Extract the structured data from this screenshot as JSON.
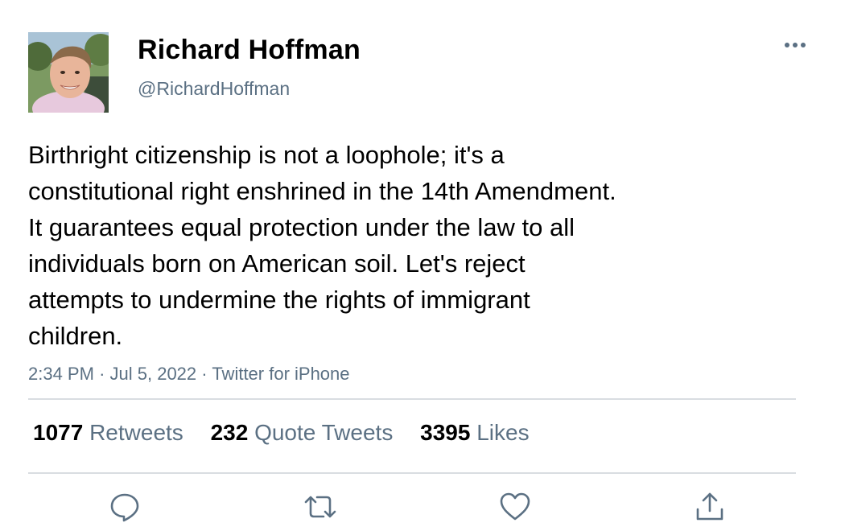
{
  "author": {
    "display_name": "Richard Hoffman",
    "handle": "@RichardHoffman",
    "avatar_icon": "profile-photo"
  },
  "tweet": {
    "text": "Birthright citizenship is not a loophole; it's a\nconstitutional right enshrined in the 14th Amendment.\nIt guarantees equal protection under the law to all\nindividuals born on American soil. Let's reject\nattempts to undermine the rights of immigrant\nchildren.",
    "time": "2:34 PM",
    "date": "Jul 5, 2022",
    "source": "Twitter for iPhone",
    "separator": "·"
  },
  "stats": {
    "retweets_count": "1077",
    "retweets_label": "Retweets",
    "quotes_count": "232",
    "quotes_label": "Quote Tweets",
    "likes_count": "3395",
    "likes_label": "Likes"
  },
  "actions": {
    "reply_icon": "reply-icon",
    "retweet_icon": "retweet-icon",
    "like_icon": "heart-icon",
    "share_icon": "share-icon",
    "more_icon": "more-icon"
  },
  "colors": {
    "secondary_text": "#5b7083",
    "divider": "#d9dde1",
    "icon": "#5b7083"
  }
}
